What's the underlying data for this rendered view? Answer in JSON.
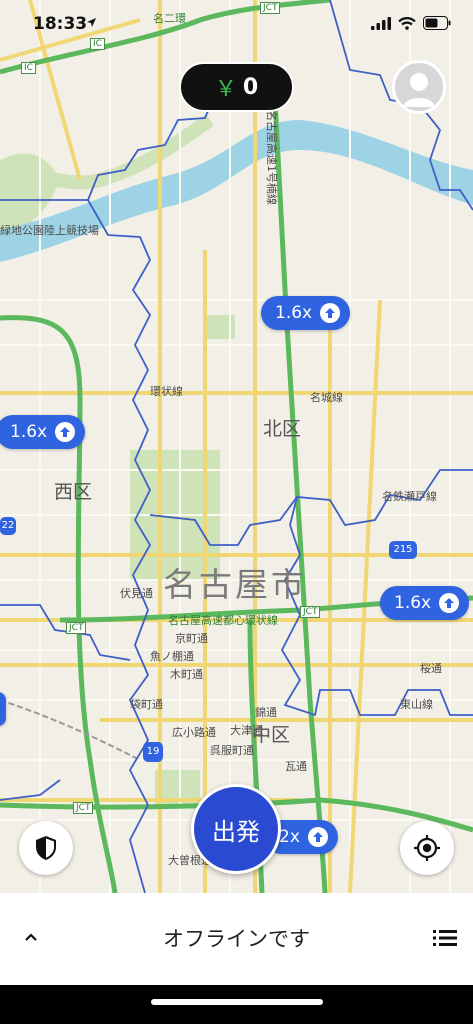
{
  "status_bar": {
    "time": "18:33"
  },
  "earnings": {
    "currency": "￥",
    "amount": "0"
  },
  "surges": [
    {
      "value": "1.6x"
    },
    {
      "value": "1.6x"
    },
    {
      "value": "1.6x"
    },
    {
      "value": "2x"
    }
  ],
  "go_button": {
    "label": "出発"
  },
  "bottom_bar": {
    "status": "オフラインです"
  },
  "map": {
    "city": "名古屋市",
    "wards": {
      "kita": "北区",
      "nishi": "西区",
      "naka": "中区"
    },
    "labels": {
      "freeway": "名古屋高速1号楠線",
      "ring_freeway": "名古屋高速都心環状線",
      "kanjo": "環状線",
      "meijo": "名城線",
      "stadium": "緑地公園陸上競技場",
      "meitetsu": "名鉄瀬戸線",
      "fushimi": "伏見通",
      "kyomachi": "京町通",
      "uonotana": "魚ノ棚通",
      "kiyamachi": "木町通",
      "fukuromachi": "袋町通",
      "hirokoji": "広小路通",
      "otsu": "大津通",
      "nishiki": "錦通",
      "gofukucho": "呉服町通",
      "kawara": "瓦通",
      "sakura": "桜通",
      "higashiyama": "東山線",
      "ozone": "大曽根通",
      "jct1": "JCT",
      "jct2": "JCT",
      "jct3": "JCT",
      "jct4": "JCT",
      "ic1": "IC",
      "ic2": "IC",
      "route19": "19",
      "route215": "215",
      "route22": "22",
      "nishikawa": "名二環"
    }
  },
  "colors": {
    "surge_blue": "#2f63e0",
    "go_blue": "#2a4bd1",
    "zone_line": "#3f5fc7",
    "freeway_green": "#5cb85c"
  }
}
